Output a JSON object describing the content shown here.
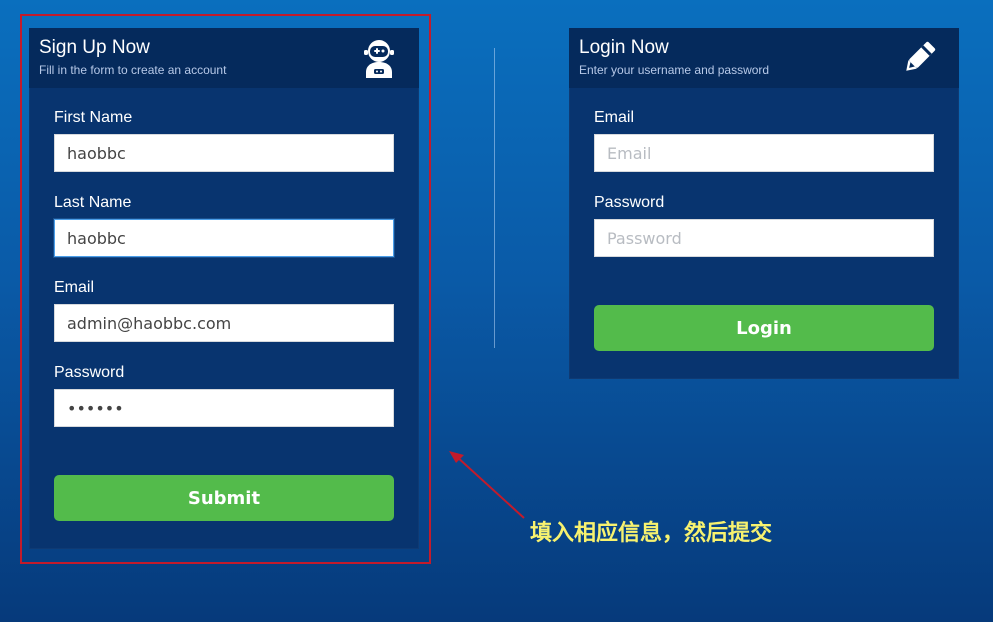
{
  "signup": {
    "title": "Sign Up Now",
    "subtitle": "Fill in the form to create an account",
    "icon": "astronaut-icon",
    "fields": {
      "first_name": {
        "label": "First Name",
        "value": "haobbc",
        "placeholder": ""
      },
      "last_name": {
        "label": "Last Name",
        "value": "haobbc",
        "placeholder": ""
      },
      "email": {
        "label": "Email",
        "value": "admin@haobbc.com",
        "placeholder": ""
      },
      "password": {
        "label": "Password",
        "value": "haobbc",
        "placeholder": ""
      }
    },
    "submit_label": "Submit"
  },
  "login": {
    "title": "Login Now",
    "subtitle": "Enter your username and password",
    "icon": "pencil-icon",
    "fields": {
      "email": {
        "label": "Email",
        "value": "",
        "placeholder": "Email"
      },
      "password": {
        "label": "Password",
        "value": "",
        "placeholder": "Password"
      }
    },
    "login_label": "Login"
  },
  "annotation": {
    "text": "填入相应信息，然后提交",
    "frame_color": "#c31b2b",
    "text_color": "#f7f26f"
  },
  "colors": {
    "background_top": "#0a6fbe",
    "background_bottom": "#063a7b",
    "card": "#08346f",
    "card_header": "#052a5c",
    "button": "#53bb4b"
  }
}
